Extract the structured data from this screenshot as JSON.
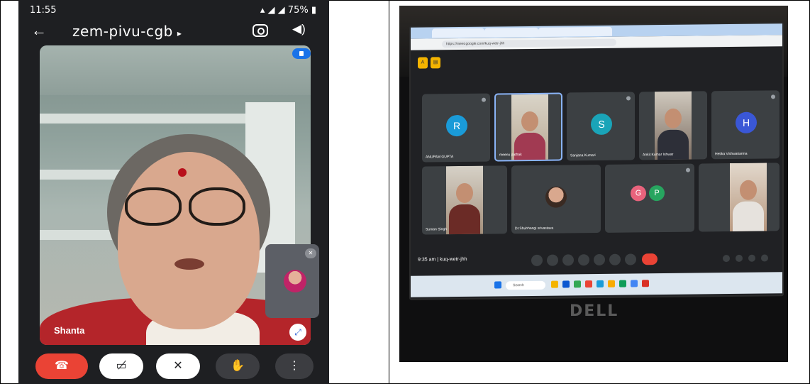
{
  "left_phone": {
    "status": {
      "time": "11:55",
      "battery": "75%"
    },
    "appbar": {
      "meeting_code": "zem-pivu-cgb"
    },
    "main_participant": {
      "name": "Shanta"
    }
  },
  "right_laptop": {
    "meeting": {
      "time": "9:35 am",
      "code": "kuq-wetr-jhh"
    },
    "browser": {
      "url": "https://meet.google.com/kuq-wetr-jhh"
    },
    "participants": [
      {
        "name": "ANUPAM GUPTA",
        "avatar": "R",
        "color": "#1a9bd8"
      },
      {
        "name": "meenu pathak",
        "avatar": "",
        "color": ""
      },
      {
        "name": "Sanjana Kumari",
        "avatar": "S",
        "color": "#1aa4b8"
      },
      {
        "name": "Ankit Kumar Ishwar",
        "avatar": "",
        "color": ""
      },
      {
        "name": "Hetika Vishwakarma",
        "avatar": "H",
        "color": "#3a57d6"
      },
      {
        "name": "Suman Singh",
        "avatar": "",
        "color": ""
      },
      {
        "name": "Dr.Shubhangi srivastava",
        "avatar": "",
        "color": ""
      },
      {
        "name": "",
        "avatar": "G",
        "color": "#e8637c"
      },
      {
        "name": "",
        "avatar": "",
        "color": ""
      }
    ],
    "taskbar": {
      "search": "Search"
    },
    "bezel_logo": "DELL"
  },
  "colors": {
    "end_call": "#ea4335",
    "meet_blue": "#1a73e8"
  }
}
